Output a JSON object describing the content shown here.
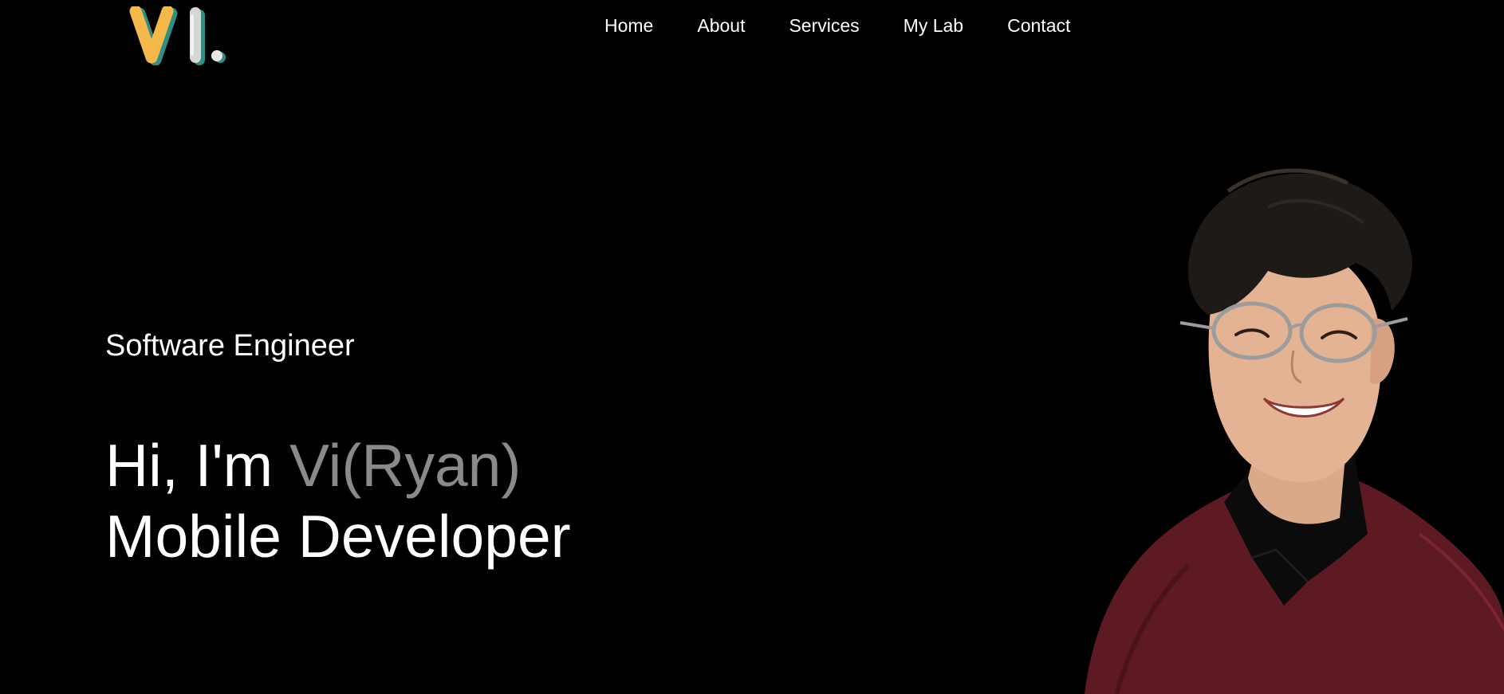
{
  "header": {
    "logo": {
      "text": "VI.",
      "colors": {
        "v": "#f5b84a",
        "i": "#d9d9d9",
        "dot": "#e8e8e8",
        "shadow": "#3aa89a"
      }
    },
    "nav": [
      {
        "label": "Home"
      },
      {
        "label": "About"
      },
      {
        "label": "Services"
      },
      {
        "label": "My Lab"
      },
      {
        "label": "Contact"
      }
    ]
  },
  "hero": {
    "role": "Software Engineer",
    "greeting": "Hi, I'm ",
    "name": "Vi(Ryan)",
    "title": "Mobile Developer",
    "colors": {
      "text": "#ffffff",
      "name": "#8a8a8a",
      "background": "#000000"
    }
  },
  "portrait": {
    "alt": "portrait photo"
  }
}
